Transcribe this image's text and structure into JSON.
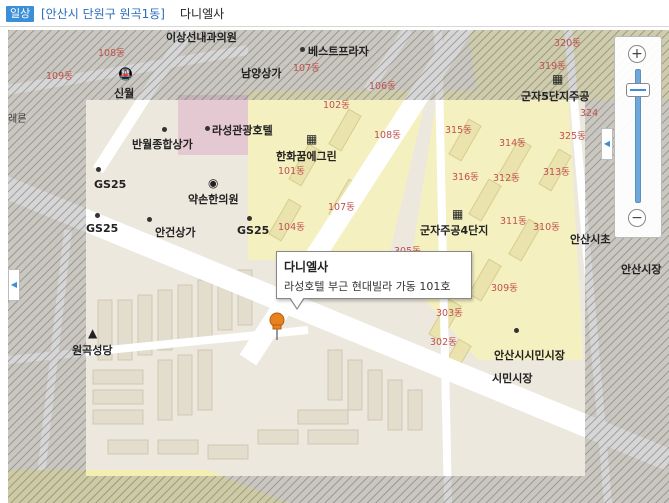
{
  "header": {
    "badge": "일상",
    "address": "[안산시 단원구 원곡1동]",
    "business_name": "다니엘사"
  },
  "popup": {
    "title": "다니엘사",
    "description": "라성호텔 부근 현대빌라 가동 101호"
  },
  "zoom": {
    "plus": "+",
    "minus": "−",
    "level_fraction": 0.12
  },
  "side_tabs": {
    "left_arrow": "◀",
    "right_arrow": "◀"
  },
  "map": {
    "places": [
      {
        "id": "sinwol",
        "text": "신월"
      },
      {
        "id": "namyang",
        "text": "남양상가"
      },
      {
        "id": "bestplaza",
        "text": "베스트프라자"
      },
      {
        "id": "isanseon",
        "text": "이상선내과의원"
      },
      {
        "id": "banwol",
        "text": "반월종합상가"
      },
      {
        "id": "raseong",
        "text": "라성관광호텔"
      },
      {
        "id": "hanhwa",
        "text": "한화꿈에그린"
      },
      {
        "id": "yakson",
        "text": "약손한의원"
      },
      {
        "id": "gs25a",
        "text": "GS25"
      },
      {
        "id": "gs25b",
        "text": "GS25"
      },
      {
        "id": "gs25c",
        "text": "GS25"
      },
      {
        "id": "angeon",
        "text": "안건상가"
      },
      {
        "id": "gunja4",
        "text": "군자주공4단지"
      },
      {
        "id": "gunja5",
        "text": "군자5단지주공"
      },
      {
        "id": "wongok",
        "text": "원곡성당"
      },
      {
        "id": "ansansimin",
        "text": "안산시시민시장"
      },
      {
        "id": "simin",
        "text": "시민시장"
      },
      {
        "id": "ansansicheong",
        "text": "안산시초"
      },
      {
        "id": "ansansijang",
        "text": "안산시장"
      },
      {
        "id": "left_edge",
        "text": "레른"
      }
    ],
    "dongs": [
      {
        "id": "d108a",
        "text": "108동"
      },
      {
        "id": "d109a",
        "text": "109동"
      },
      {
        "id": "d107a",
        "text": "107동"
      },
      {
        "id": "d106a",
        "text": "106동"
      },
      {
        "id": "d102",
        "text": "102동"
      },
      {
        "id": "d108b",
        "text": "108동"
      },
      {
        "id": "d101",
        "text": "101동"
      },
      {
        "id": "d107b",
        "text": "107동"
      },
      {
        "id": "d104",
        "text": "104동"
      },
      {
        "id": "d320",
        "text": "320동"
      },
      {
        "id": "d319",
        "text": "319동"
      },
      {
        "id": "d315",
        "text": "315동"
      },
      {
        "id": "d314",
        "text": "314동"
      },
      {
        "id": "d325",
        "text": "325동"
      },
      {
        "id": "d316",
        "text": "316동"
      },
      {
        "id": "d312",
        "text": "312동"
      },
      {
        "id": "d313",
        "text": "313동"
      },
      {
        "id": "d311",
        "text": "311동"
      },
      {
        "id": "d310",
        "text": "310동"
      },
      {
        "id": "d309",
        "text": "309동"
      },
      {
        "id": "d303",
        "text": "303동"
      },
      {
        "id": "d302",
        "text": "302동"
      },
      {
        "id": "d305",
        "text": "305동"
      },
      {
        "id": "d324",
        "text": "324"
      }
    ]
  },
  "colors": {
    "badge": "#3b8fd6",
    "address": "#2a6ebd",
    "apartment": "#f5f0bf",
    "road": "#ffffff",
    "block": "#e6e2d8",
    "marker": "#e8821e"
  }
}
